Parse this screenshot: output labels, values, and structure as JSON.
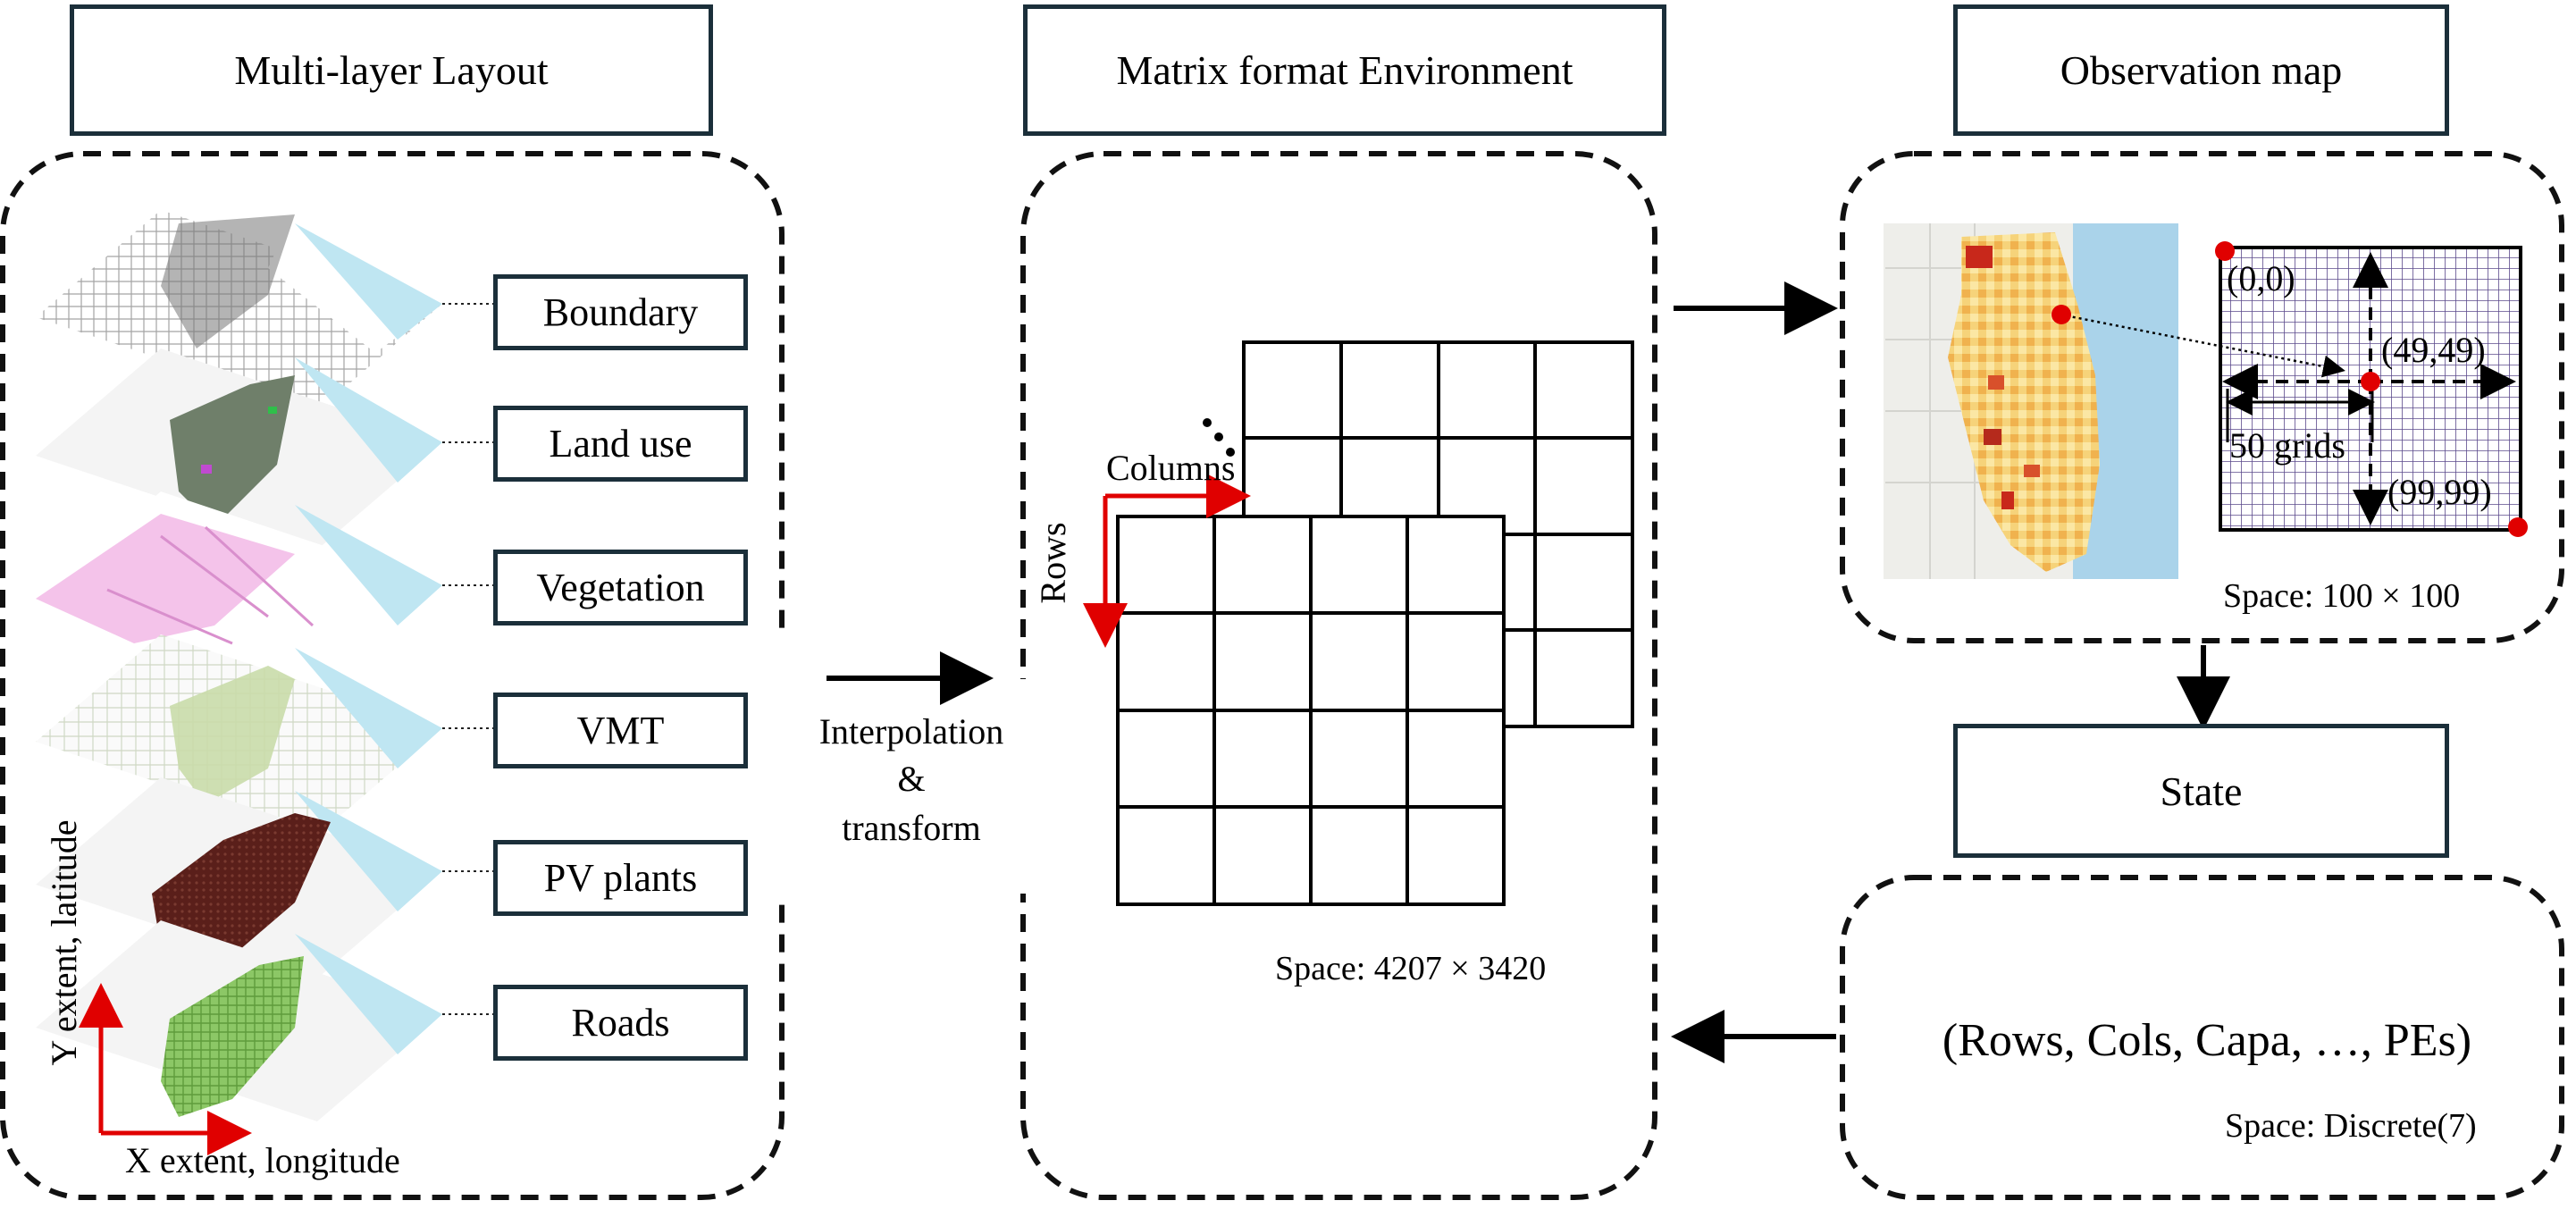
{
  "sections": {
    "layout_title": "Multi-layer Layout",
    "matrix_title": "Matrix format Environment",
    "observation_title": "Observation map",
    "state_title": "State"
  },
  "layers": [
    "Boundary",
    "Land use",
    "Vegetation",
    "VMT",
    "PV plants",
    "Roads"
  ],
  "layout_axes": {
    "y": "Y extent, latitude",
    "x": "X extent, longitude"
  },
  "interpolation": {
    "line1": "Interpolation",
    "line2": "&",
    "line3": "transform"
  },
  "matrix": {
    "columns": "Columns",
    "rows": "Rows",
    "space": "Space: 4207 × 3420"
  },
  "observation": {
    "origin": "(0,0)",
    "center": "(49,49)",
    "end": "(99,99)",
    "grids": "50 grids",
    "space": "Space: 100 × 100"
  },
  "state": {
    "tuple": "(Rows, Cols, Capa, …, PEs)",
    "space": "Space: Discrete(7)"
  },
  "colors": {
    "frame": "#1b2f3a",
    "accent_red": "#e00000",
    "grid_purple": "#5b4a8c",
    "water": "#bfe6f2",
    "landuse": "#6f7f6a",
    "vegetation": "#f2b8e6",
    "vmt": "#c9dcaa",
    "pv": "#5a1f1a",
    "roads": "#7fbf56"
  }
}
